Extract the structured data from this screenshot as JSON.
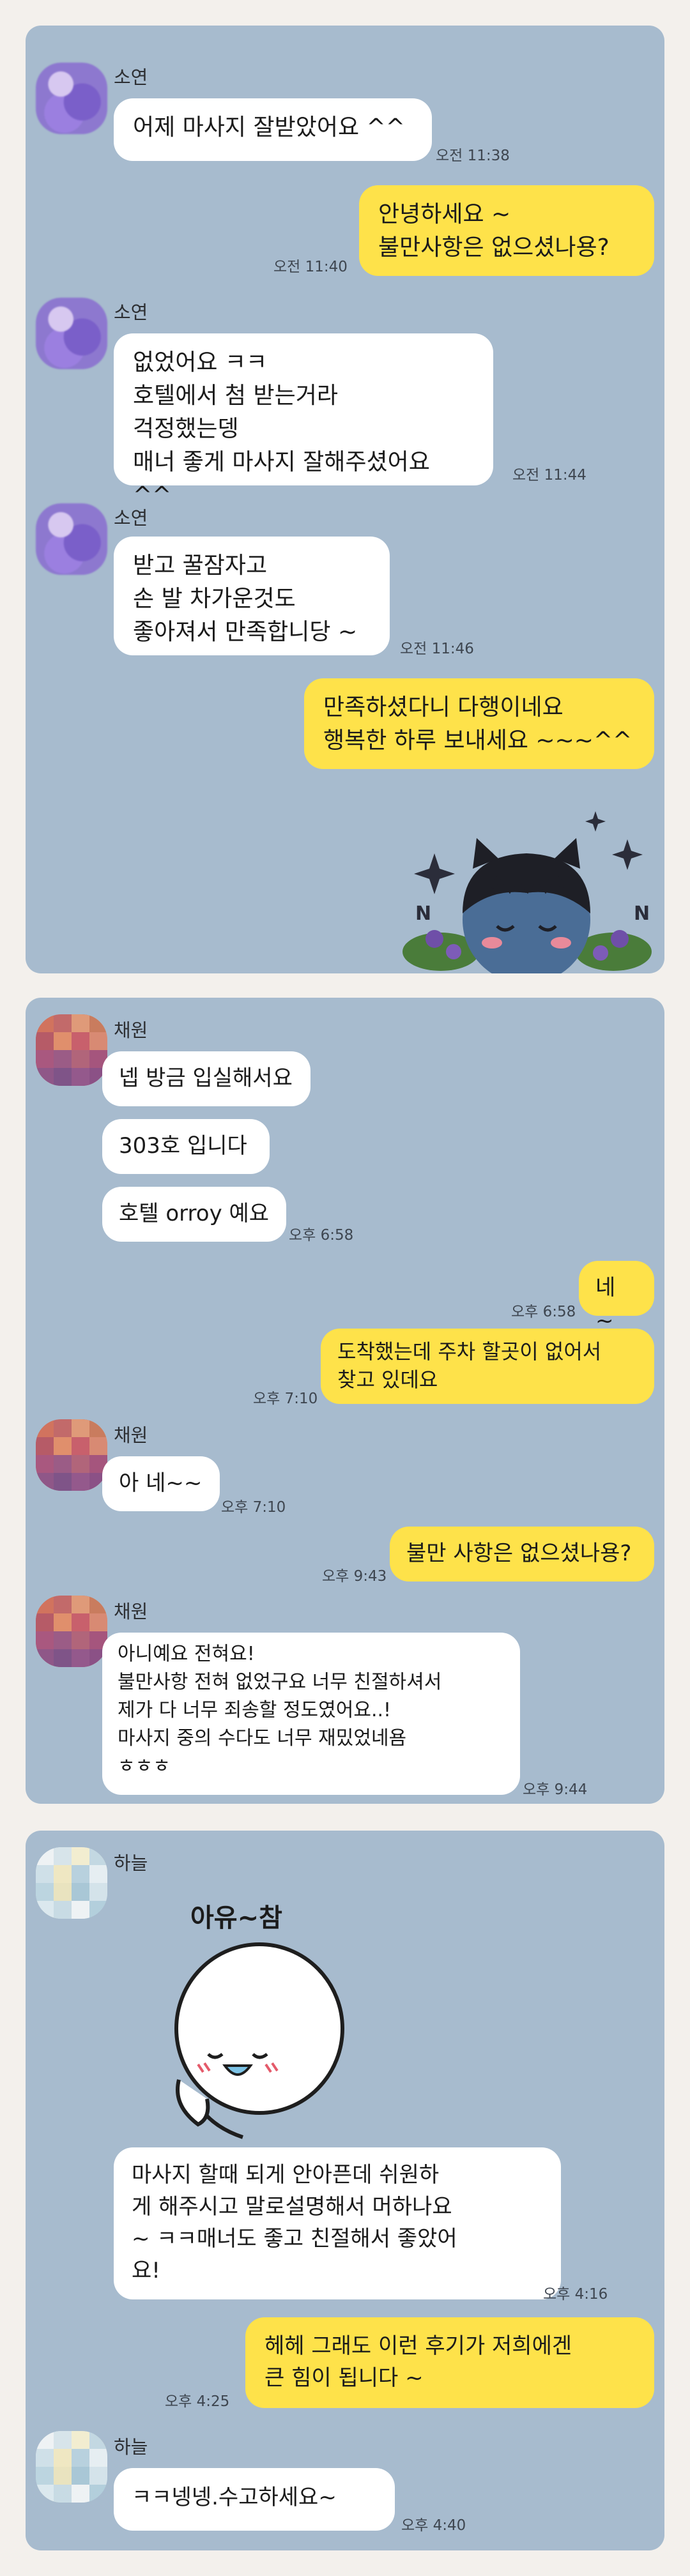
{
  "panel1": {
    "sender": "소연",
    "messages": [
      {
        "text": "어제 마사지 잘받았어요 ^^",
        "time": "오전 11:38"
      },
      {
        "text": "안녕하세요 ~\n불만사항은 없으셨나용?",
        "time": "오전 11:40"
      },
      {
        "text": "없었어요 ㅋㅋ\n호텔에서 첨 받는거라\n걱정했는뎅\n매너 좋게 마사지 잘해주셨어요 ^^",
        "time": "오전 11:44"
      },
      {
        "text": "받고 꿀잠자고\n손 발 차가운것도\n좋아져서 만족합니당 ~",
        "time": "오전 11:46"
      },
      {
        "text": "만족하셨다니 다행이네요\n행복한 하루 보내세요 ~~~^^",
        "time": ""
      }
    ]
  },
  "panel2": {
    "sender": "채원",
    "messages": [
      {
        "text": "넵 방금 입실해서요",
        "time": ""
      },
      {
        "text": "303호 입니다",
        "time": ""
      },
      {
        "text": "호텔 orroy 예요",
        "time": "오후 6:58"
      },
      {
        "text": "네 ~",
        "time": "오후 6:58"
      },
      {
        "text": "도착했는데  주차 할곳이 없어서\n찾고 있데요",
        "time": "오후 7:10"
      },
      {
        "text": "아 네~~",
        "time": "오후 7:10"
      },
      {
        "text": "불만 사항은 없으셨나용?",
        "time": "오후 9:43"
      },
      {
        "text": "아니예요 전혀요!\n불만사항 전혀 없었구요 너무 친절하셔서\n제가 다 너무 죄송할 정도였어요..!\n마사지 중의 수다도 너무 재밌었네욤\nㅎㅎㅎ",
        "time": "오후 9:44"
      }
    ]
  },
  "panel3": {
    "sender": "하늘",
    "sticker_caption": "아유~참",
    "messages": [
      {
        "text": "마사지 할때 되게 안아픈데 쉬원하\n게 해주시고 말로설명해서 머하나요\n~ ㅋㅋ매너도 좋고 친절해서 좋았어\n요!",
        "time": "오후 4:16"
      },
      {
        "text": "헤헤 그래도 이런 후기가 저희에겐\n큰 힘이 됩니다 ~",
        "time": "오후 4:25"
      },
      {
        "text": "ㅋㅋ넹넹.수고하세요~",
        "time": "오후 4:40"
      }
    ]
  },
  "colors": {
    "chat_background": "#a7bbce",
    "incoming_bubble": "#ffffff",
    "outgoing_bubble": "#fee24a",
    "page_background": "#f3f0ec"
  }
}
